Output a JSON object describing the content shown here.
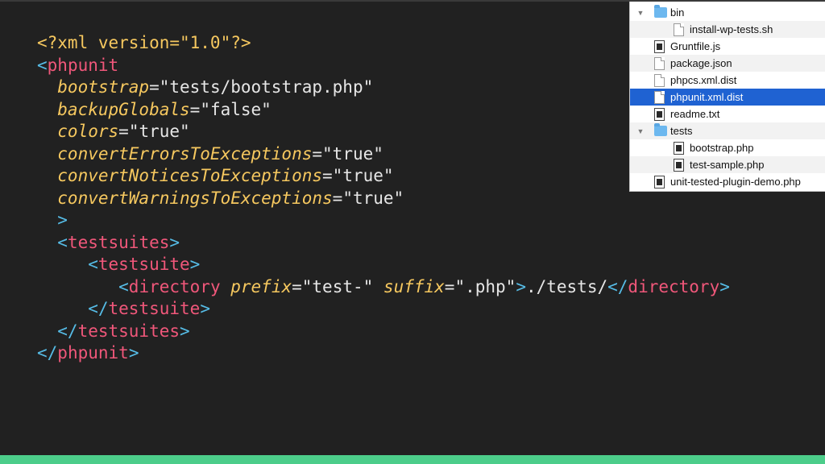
{
  "code": {
    "lines": [
      [
        {
          "t": "<?xml version=\"1.0\"?>",
          "c": "decl"
        }
      ],
      [
        {
          "t": "<",
          "c": "punct"
        },
        {
          "t": "phpunit",
          "c": "tag"
        }
      ],
      [
        {
          "t": "  bootstrap",
          "c": "attr"
        },
        {
          "t": "=",
          "c": "eq"
        },
        {
          "t": "\"tests/bootstrap.php\"",
          "c": "str"
        }
      ],
      [
        {
          "t": "  backupGlobals",
          "c": "attr"
        },
        {
          "t": "=",
          "c": "eq"
        },
        {
          "t": "\"false\"",
          "c": "str"
        }
      ],
      [
        {
          "t": "  colors",
          "c": "attr"
        },
        {
          "t": "=",
          "c": "eq"
        },
        {
          "t": "\"true\"",
          "c": "str"
        }
      ],
      [
        {
          "t": "  convertErrorsToExceptions",
          "c": "attr"
        },
        {
          "t": "=",
          "c": "eq"
        },
        {
          "t": "\"true\"",
          "c": "str"
        }
      ],
      [
        {
          "t": "  convertNoticesToExceptions",
          "c": "attr"
        },
        {
          "t": "=",
          "c": "eq"
        },
        {
          "t": "\"true\"",
          "c": "str"
        }
      ],
      [
        {
          "t": "  convertWarningsToExceptions",
          "c": "attr"
        },
        {
          "t": "=",
          "c": "eq"
        },
        {
          "t": "\"true\"",
          "c": "str"
        }
      ],
      [
        {
          "t": "  >",
          "c": "punct"
        }
      ],
      [
        {
          "t": "  <",
          "c": "punct"
        },
        {
          "t": "testsuites",
          "c": "tag"
        },
        {
          "t": ">",
          "c": "punct"
        }
      ],
      [
        {
          "t": "     <",
          "c": "punct"
        },
        {
          "t": "testsuite",
          "c": "tag"
        },
        {
          "t": ">",
          "c": "punct"
        }
      ],
      [
        {
          "t": "        <",
          "c": "punct"
        },
        {
          "t": "directory",
          "c": "tag"
        },
        {
          "t": " ",
          "c": "text"
        },
        {
          "t": "prefix",
          "c": "attr"
        },
        {
          "t": "=",
          "c": "eq"
        },
        {
          "t": "\"test-\"",
          "c": "str"
        },
        {
          "t": " ",
          "c": "text"
        },
        {
          "t": "suffix",
          "c": "attr"
        },
        {
          "t": "=",
          "c": "eq"
        },
        {
          "t": "\".php\"",
          "c": "str"
        },
        {
          "t": ">",
          "c": "punct"
        },
        {
          "t": "./tests/",
          "c": "text"
        },
        {
          "t": "</",
          "c": "punct"
        },
        {
          "t": "directory",
          "c": "tag"
        },
        {
          "t": ">",
          "c": "punct"
        }
      ],
      [
        {
          "t": "     </",
          "c": "punct"
        },
        {
          "t": "testsuite",
          "c": "tag"
        },
        {
          "t": ">",
          "c": "punct"
        }
      ],
      [
        {
          "t": "  </",
          "c": "punct"
        },
        {
          "t": "testsuites",
          "c": "tag"
        },
        {
          "t": ">",
          "c": "punct"
        }
      ],
      [
        {
          "t": "</",
          "c": "punct"
        },
        {
          "t": "phpunit",
          "c": "tag"
        },
        {
          "t": ">",
          "c": "punct"
        }
      ]
    ]
  },
  "file_tree": {
    "items": [
      {
        "name": "bin",
        "kind": "folder",
        "level": 0,
        "expanded": true,
        "icon": "folder-icon"
      },
      {
        "name": "install-wp-tests.sh",
        "kind": "doc",
        "level": 1,
        "icon": "document-icon"
      },
      {
        "name": "Gruntfile.js",
        "kind": "exec",
        "level": 0,
        "icon": "executable-icon"
      },
      {
        "name": "package.json",
        "kind": "doc",
        "level": 0,
        "icon": "document-icon"
      },
      {
        "name": "phpcs.xml.dist",
        "kind": "doc",
        "level": 0,
        "icon": "document-icon"
      },
      {
        "name": "phpunit.xml.dist",
        "kind": "doc",
        "level": 0,
        "selected": true,
        "icon": "document-icon"
      },
      {
        "name": "readme.txt",
        "kind": "exec",
        "level": 0,
        "icon": "executable-icon"
      },
      {
        "name": "tests",
        "kind": "folder",
        "level": 0,
        "expanded": true,
        "icon": "folder-icon"
      },
      {
        "name": "bootstrap.php",
        "kind": "exec",
        "level": 1,
        "icon": "executable-icon"
      },
      {
        "name": "test-sample.php",
        "kind": "exec",
        "level": 1,
        "icon": "executable-icon"
      },
      {
        "name": "unit-tested-plugin-demo.php",
        "kind": "exec",
        "level": 0,
        "icon": "executable-icon"
      }
    ]
  },
  "colors": {
    "background": "#212121",
    "accent_bar": "#4ccd8a",
    "selection": "#1f62d2",
    "xml_tag": "#f0577a",
    "xml_punct": "#56bce6",
    "xml_attr": "#f6c85f"
  }
}
